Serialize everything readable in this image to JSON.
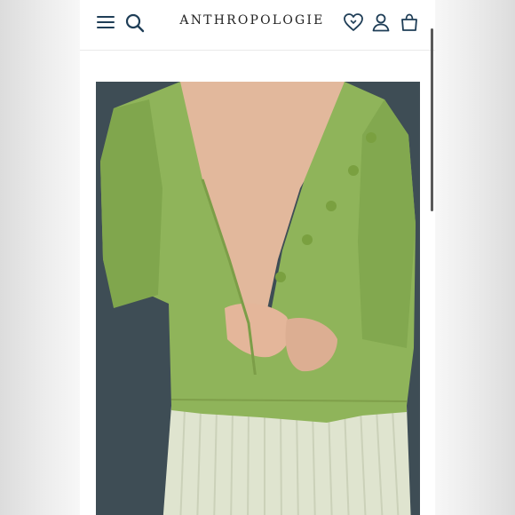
{
  "header": {
    "brand": "ANTHROPOLOGIE",
    "icons": {
      "menu": "menu-icon",
      "search": "search-icon",
      "wishlist": "heart-icon",
      "account": "account-icon",
      "bag": "bag-icon"
    }
  },
  "product": {
    "image": "product-photo-green-cardigan"
  },
  "colors": {
    "accent": "#1f3e57",
    "cardigan": "#8fb45a",
    "skirt": "#dfe4cf",
    "backdrop": "#3e4d55"
  }
}
